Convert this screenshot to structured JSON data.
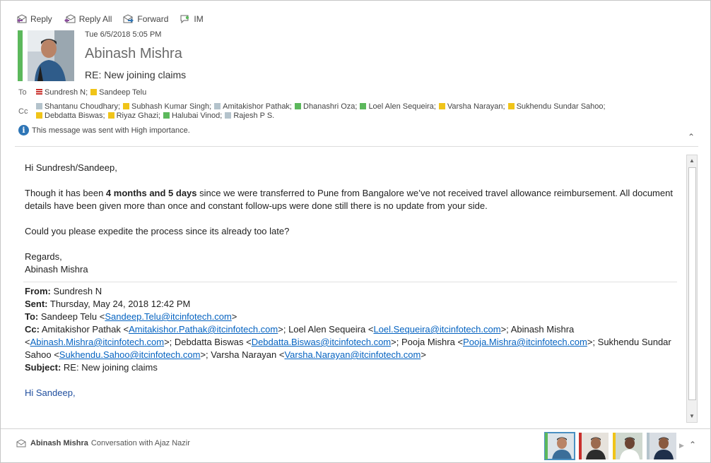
{
  "toolbar": {
    "reply": "Reply",
    "reply_all": "Reply All",
    "forward": "Forward",
    "im": "IM"
  },
  "header": {
    "date": "Tue 6/5/2018 5:05 PM",
    "sender": "Abinash Mishra",
    "subject": "RE: New joining claims",
    "to_label": "To",
    "cc_label": "Cc",
    "to": [
      {
        "name": "Sundresh N;",
        "status": "red"
      },
      {
        "name": "Sandeep Telu",
        "status": "yellow"
      }
    ],
    "cc": [
      {
        "name": "Shantanu Choudhary;",
        "status": "grey"
      },
      {
        "name": "Subhash Kumar Singh;",
        "status": "yellow"
      },
      {
        "name": "Amitakishor Pathak;",
        "status": "grey"
      },
      {
        "name": "Dhanashri  Oza;",
        "status": "green"
      },
      {
        "name": "Loel Alen Sequeira;",
        "status": "green"
      },
      {
        "name": "Varsha Narayan;",
        "status": "yellow"
      },
      {
        "name": "Sukhendu Sundar Sahoo;",
        "status": "yellow"
      },
      {
        "name": "Debdatta Biswas;",
        "status": "yellow"
      },
      {
        "name": "Riyaz  Ghazi;",
        "status": "yellow"
      },
      {
        "name": "Halubai Vinod;",
        "status": "green"
      },
      {
        "name": "Rajesh P S.",
        "status": "grey"
      }
    ],
    "importance": "This message was sent with High importance."
  },
  "body": {
    "greeting": "Hi Sundresh/Sandeep,",
    "p1_a": "Though it has been ",
    "p1_b1": "4 months and 5 days",
    "p1_c": " since we were transferred to Pune from Bangalore we’ve not received travel allowance reimbursement. All document details have been given more than once and constant follow-ups were done still there is no update from your side.",
    "p2": "Could you please expedite the process since its already too late?",
    "regards": "Regards,",
    "signature": "Abinash Mishra"
  },
  "quoted": {
    "from_label": "From:",
    "from": "Sundresh N",
    "sent_label": "Sent:",
    "sent": "Thursday, May 24, 2018 12:42 PM",
    "to_label": "To:",
    "to_name": "Sandeep Telu <",
    "to_email": "Sandeep.Telu@itcinfotech.com",
    "cc_label": "Cc:",
    "cc": [
      {
        "pre": "Amitakishor Pathak <",
        "email": "Amitakishor.Pathak@itcinfotech.com",
        "post": ">; "
      },
      {
        "pre": "Loel Alen Sequeira <",
        "email": "Loel.Sequeira@itcinfotech.com",
        "post": ">; "
      },
      {
        "pre": "Abinash Mishra <",
        "email": "Abinash.Mishra@itcinfotech.com",
        "post": ">; "
      },
      {
        "pre": "Debdatta Biswas <",
        "email": "Debdatta.Biswas@itcinfotech.com",
        "post": ">; "
      },
      {
        "pre": "Pooja Mishra <",
        "email": "Pooja.Mishra@itcinfotech.com",
        "post": ">; "
      },
      {
        "pre": "Sukhendu Sundar Sahoo <",
        "email": "Sukhendu.Sahoo@itcinfotech.com",
        "post": ">; "
      },
      {
        "pre": "Varsha Narayan <",
        "email": "Varsha.Narayan@itcinfotech.com",
        "post": ">"
      }
    ],
    "subject_label": "Subject:",
    "subject": "RE: New joining claims",
    "greeting": "Hi Sandeep,"
  },
  "footer": {
    "name": "Abinash Mishra",
    "conversation": "Conversation with Ajaz Nazir",
    "thumbnails": [
      {
        "bar": "#5cb85c",
        "selected": true
      },
      {
        "bar": "#c9302c",
        "selected": false
      },
      {
        "bar": "#f0c419",
        "selected": false
      },
      {
        "bar": "#b4c3cc",
        "selected": false
      }
    ]
  },
  "colors": {
    "available": "#5cb85c",
    "busy": "#c9302c",
    "away": "#f0c419",
    "offline": "#b4c3cc",
    "link": "#0563c1"
  }
}
